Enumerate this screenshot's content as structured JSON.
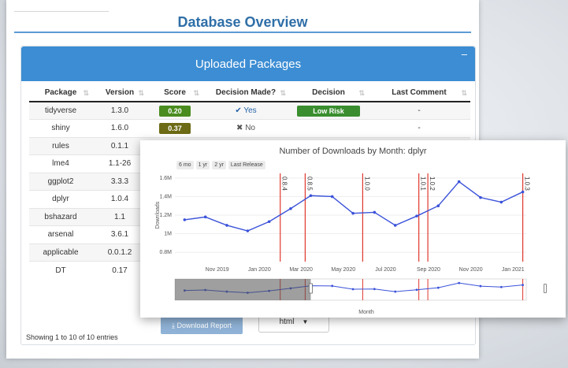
{
  "page": {
    "title": "Database Overview"
  },
  "card": {
    "title": "Uploaded Packages",
    "collapse_icon": "–"
  },
  "table": {
    "columns": [
      "Package",
      "Version",
      "Score",
      "Decision Made?",
      "Decision",
      "Last Comment"
    ],
    "rows": [
      {
        "package": "tidyverse",
        "version": "1.3.0",
        "score": "0.20",
        "decision_made": "Yes",
        "decision": "Low Risk",
        "comment": "-"
      },
      {
        "package": "shiny",
        "version": "1.6.0",
        "score": "0.37",
        "decision_made": "No",
        "decision": "",
        "comment": "-"
      },
      {
        "package": "rules",
        "version": "0.1.1"
      },
      {
        "package": "lme4",
        "version": "1.1-26"
      },
      {
        "package": "ggplot2",
        "version": "3.3.3"
      },
      {
        "package": "dplyr",
        "version": "1.0.4"
      },
      {
        "package": "bshazard",
        "version": "1.1"
      },
      {
        "package": "arsenal",
        "version": "3.6.1"
      },
      {
        "package": "applicable",
        "version": "0.0.1.2"
      },
      {
        "package": "DT",
        "version": "0.17"
      }
    ]
  },
  "footer": {
    "showing": "Showing 1 to 10 of 10 entries",
    "download_button": "Download Report",
    "format_value": "html"
  },
  "colors": {
    "accent": "#3c8dd3",
    "line": "#3b52d9",
    "release": "#e0362c"
  },
  "chart": {
    "range_buttons": [
      "6 mo",
      "1 yr",
      "2 yr",
      "Last Release"
    ]
  },
  "chart_data": {
    "type": "line",
    "title": "Number of Downloads by Month: dplyr",
    "xlabel": "Month",
    "ylabel": "Downloads",
    "x_ticks": [
      "Nov 2019",
      "Jan 2020",
      "Mar 2020",
      "May 2020",
      "Jul 2020",
      "Sep 2020",
      "Nov 2020",
      "Jan 2021"
    ],
    "y_ticks": [
      "0.8M",
      "1M",
      "1.2M",
      "1.4M",
      "1.6M"
    ],
    "ylim": [
      0.75,
      1.65
    ],
    "x": [
      "2019-09",
      "2019-10",
      "2019-11",
      "2019-12",
      "2020-01",
      "2020-02",
      "2020-03",
      "2020-04",
      "2020-05",
      "2020-06",
      "2020-07",
      "2020-08",
      "2020-09",
      "2020-10",
      "2020-11",
      "2020-12",
      "2021-01"
    ],
    "series": [
      {
        "values": [
          1.15,
          1.18,
          1.09,
          1.03,
          1.13,
          1.27,
          1.41,
          1.4,
          1.22,
          1.23,
          1.09,
          1.19,
          1.3,
          1.56,
          1.39,
          1.34,
          1.45
        ]
      }
    ],
    "releases": [
      {
        "version": "0.8.4",
        "date": "2020-01-31"
      },
      {
        "version": "0.8.5",
        "date": "2020-03-07"
      },
      {
        "version": "1.0.0",
        "date": "2020-05-29"
      },
      {
        "version": "1.0.1",
        "date": "2020-08-18"
      },
      {
        "version": "1.0.2",
        "date": "2020-08-31"
      },
      {
        "version": "1.0.3",
        "date": "2021-01-15"
      }
    ],
    "range_selector": "Mar 2020"
  }
}
